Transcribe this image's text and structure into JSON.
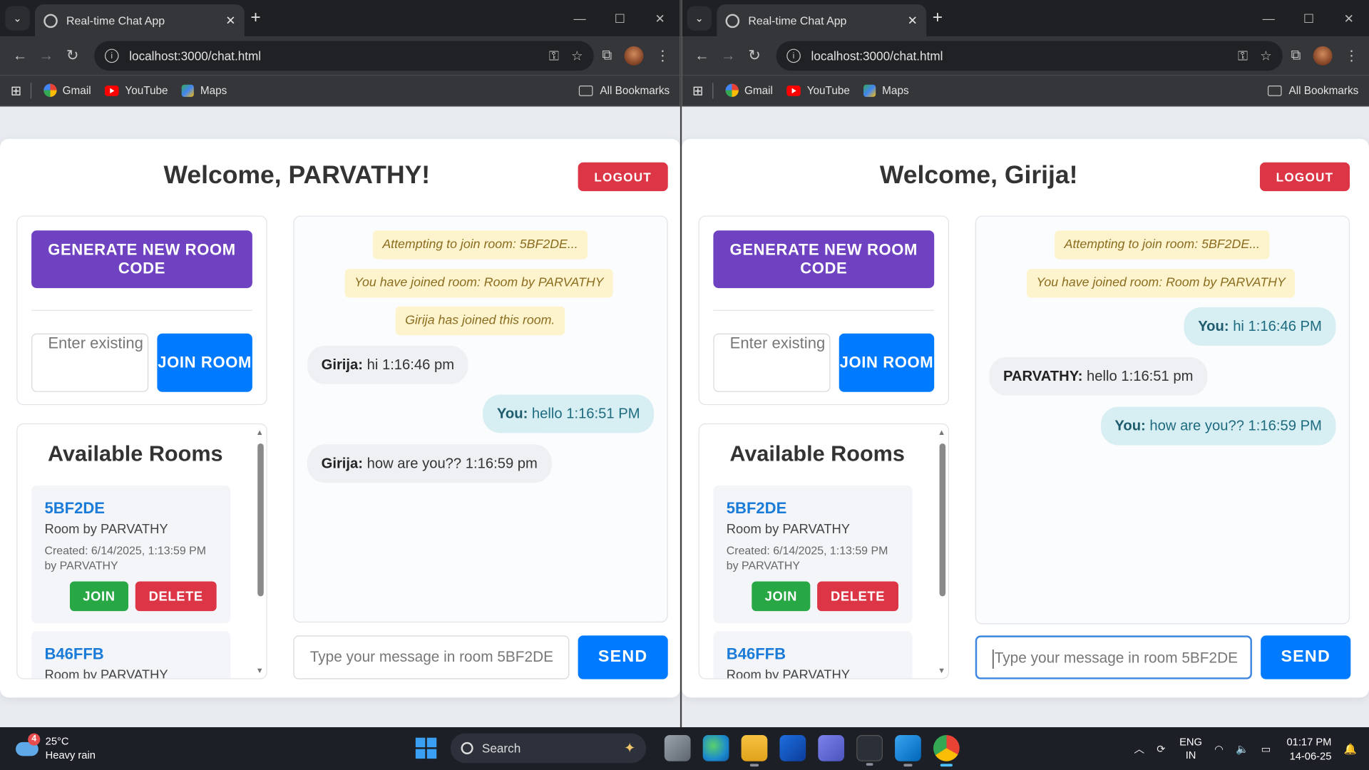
{
  "browser": {
    "tab_title": "Real-time Chat App",
    "url": "localhost:3000/chat.html",
    "bookmarks": [
      "Gmail",
      "YouTube",
      "Maps"
    ],
    "all_bookmarks": "All Bookmarks"
  },
  "left": {
    "welcome": "Welcome, PARVATHY!",
    "logout": "LOGOUT",
    "generate": "GENERATE NEW ROOM CODE",
    "room_placeholder": "Enter existing room code",
    "join_room": "JOIN ROOM",
    "rooms_title": "Available Rooms",
    "rooms": [
      {
        "code": "5BF2DE",
        "name": "Room by PARVATHY",
        "created": "Created: 6/14/2025, 1:13:59 PM by PARVATHY",
        "join": "JOIN",
        "delete": "DELETE"
      },
      {
        "code": "B46FFB",
        "name": "Room by PARVATHY"
      }
    ],
    "messages": [
      {
        "kind": "system",
        "text": "Attempting to join room: 5BF2DE..."
      },
      {
        "kind": "system",
        "text": "You have joined room: Room by PARVATHY"
      },
      {
        "kind": "system",
        "text": "Girija has joined this room."
      },
      {
        "kind": "in",
        "sender": "Girija:",
        "text": " hi 1:16:46 pm"
      },
      {
        "kind": "out",
        "sender": "You:",
        "text": " hello 1:16:51 PM"
      },
      {
        "kind": "in",
        "sender": "Girija:",
        "text": " how are you?? 1:16:59 pm"
      }
    ],
    "input_placeholder": "Type your message in room 5BF2DE",
    "send": "SEND"
  },
  "right": {
    "welcome": "Welcome, Girija!",
    "logout": "LOGOUT",
    "generate": "GENERATE NEW ROOM CODE",
    "room_placeholder": "Enter existing room code",
    "join_room": "JOIN ROOM",
    "rooms_title": "Available Rooms",
    "rooms": [
      {
        "code": "5BF2DE",
        "name": "Room by PARVATHY",
        "created": "Created: 6/14/2025, 1:13:59 PM by PARVATHY",
        "join": "JOIN",
        "delete": "DELETE"
      },
      {
        "code": "B46FFB",
        "name": "Room by PARVATHY"
      }
    ],
    "messages": [
      {
        "kind": "system",
        "text": "Attempting to join room: 5BF2DE..."
      },
      {
        "kind": "system",
        "text": "You have joined room: Room by PARVATHY"
      },
      {
        "kind": "out",
        "sender": "You:",
        "text": " hi 1:16:46 PM"
      },
      {
        "kind": "in",
        "sender": "PARVATHY:",
        "text": " hello 1:16:51 pm"
      },
      {
        "kind": "out",
        "sender": "You:",
        "text": " how are you?? 1:16:59 PM"
      }
    ],
    "input_placeholder": "Type your message in room 5BF2DE",
    "send": "SEND"
  },
  "taskbar": {
    "weather_badge": "4",
    "temperature": "25°C",
    "weather": "Heavy rain",
    "search": "Search",
    "lang_top": "ENG",
    "lang_bottom": "IN",
    "time": "01:17 PM",
    "date": "14-06-25"
  },
  "colors": {
    "accent_purple": "#6f42c1",
    "primary_blue": "#007bff",
    "danger_red": "#dc3545",
    "success_green": "#28a745"
  }
}
